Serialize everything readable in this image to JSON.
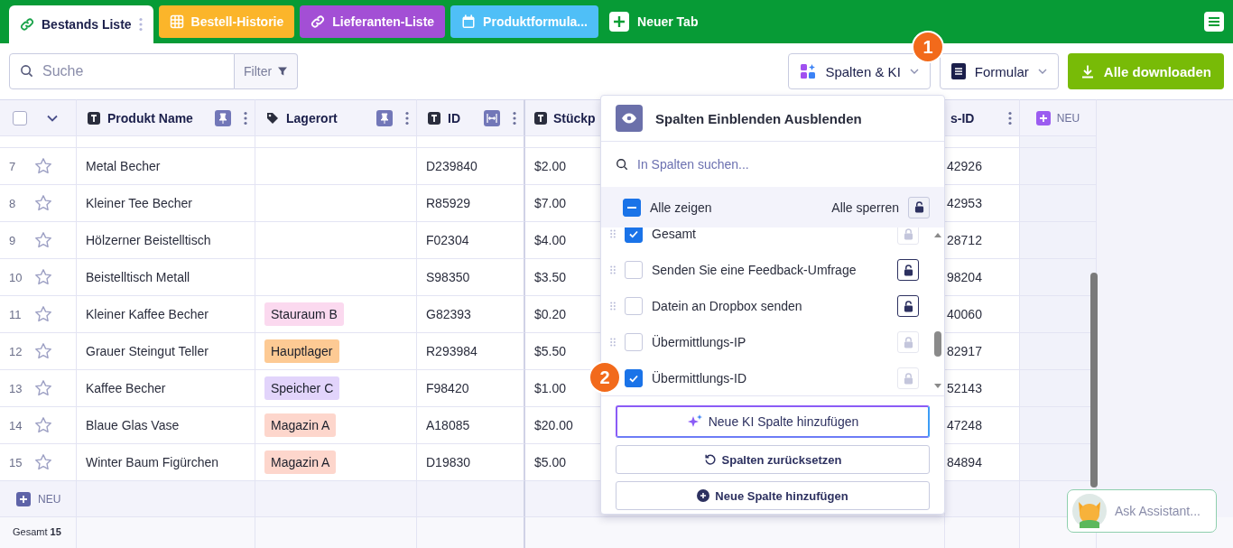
{
  "tabs": [
    {
      "label": "Bestands Liste",
      "selected": true,
      "color": "#ffffff"
    },
    {
      "label": "Bestell-Historie",
      "selected": false,
      "color": "#fbb52a"
    },
    {
      "label": "Lieferanten-Liste",
      "selected": false,
      "color": "#a34fd5"
    },
    {
      "label": "Produktformula...",
      "selected": false,
      "color": "#4fbff7"
    }
  ],
  "new_tab": "Neuer Tab",
  "toolbar": {
    "search": {
      "placeholder": "Suche"
    },
    "filter": "Filter",
    "columns_button": "Spalten & KI",
    "form_button": "Formular",
    "download_button": "Alle downloaden"
  },
  "table": {
    "select_all": {
      "checked": false
    },
    "columns": [
      {
        "title": "Produkt Name"
      },
      {
        "title": "Lagerort"
      },
      {
        "title": "ID"
      },
      {
        "title": "Stückp"
      },
      {
        "title": "s-ID"
      }
    ],
    "new_column": "NEU",
    "rows": [
      {
        "number": "7",
        "starred": false,
        "name": "Metal Becher",
        "id": "D239840",
        "price": "$2.00",
        "column_5": "42926"
      },
      {
        "number": "8",
        "starred": false,
        "name": "Kleiner Tee Becher",
        "id": "R85929",
        "price": "$7.00",
        "column_5": "42953"
      },
      {
        "number": "9",
        "starred": false,
        "name": "Hölzerner Beistelltisch",
        "id": "F02304",
        "price": "$4.00",
        "column_5": "28712"
      },
      {
        "number": "10",
        "starred": false,
        "name": "Beistelltisch Metall",
        "id": "S98350",
        "price": "$3.50",
        "column_5": "98204"
      },
      {
        "number": "11",
        "starred": false,
        "name": "Kleiner Kaffee Becher",
        "location": {
          "label": "Stauraum B",
          "color": "#fbd9ef"
        },
        "id": "G82393",
        "price": "$0.20",
        "column_5": "40060"
      },
      {
        "number": "12",
        "starred": false,
        "name": "Grauer Steingut Teller",
        "location": {
          "label": "Hauptlager",
          "color": "#fdca94"
        },
        "id": "R293984",
        "price": "$5.50",
        "column_5": "82917"
      },
      {
        "number": "13",
        "starred": false,
        "name": "Kaffee Becher",
        "location": {
          "label": "Speicher C",
          "color": "#e2d4fb"
        },
        "id": "F98420",
        "price": "$1.00",
        "column_5": "52143"
      },
      {
        "number": "14",
        "starred": false,
        "name": "Blaue Glas Vase",
        "location": {
          "label": "Magazin A",
          "color": "#fdd6cc"
        },
        "id": "A18085",
        "price": "$20.00",
        "column_5": "47248"
      },
      {
        "number": "15",
        "starred": false,
        "name": "Winter Baum Figürchen",
        "location": {
          "label": "Magazin A",
          "color": "#fdd6cc"
        },
        "id": "D19830",
        "price": "$5.00",
        "column_5": "84894"
      }
    ],
    "add_row": "NEU",
    "footer": "Gesamt **15**"
  },
  "panel": {
    "title": "Spalten Einblenden Ausblenden",
    "search": {
      "placeholder": "In Spalten suchen..."
    },
    "show_all": {
      "label": "Alle zeigen",
      "indeterminate": true
    },
    "lock_all": "Alle sperren",
    "items": [
      {
        "label": "Gesamt",
        "checked": true,
        "disabled": true
      },
      {
        "label": "Senden Sie eine Feedback-Umfrage",
        "checked": false,
        "disabled": false
      },
      {
        "label": "Datein an Dropbox senden",
        "checked": false,
        "disabled": false
      },
      {
        "label": "Übermittlungs-IP",
        "checked": false,
        "disabled": true
      },
      {
        "label": "Übermittlungs-ID",
        "checked": true,
        "disabled": true
      }
    ],
    "buttons": [
      {
        "label": "Neue KI Spalte hinzufügen",
        "kind": "ai"
      },
      {
        "label": "Spalten zurücksetzen",
        "kind": "reset"
      },
      {
        "label": "Neue Spalte hinzufügen",
        "kind": "add"
      }
    ]
  },
  "badges": [
    "1",
    "2"
  ],
  "assistant": {
    "placeholder": "Ask Assistant..."
  }
}
